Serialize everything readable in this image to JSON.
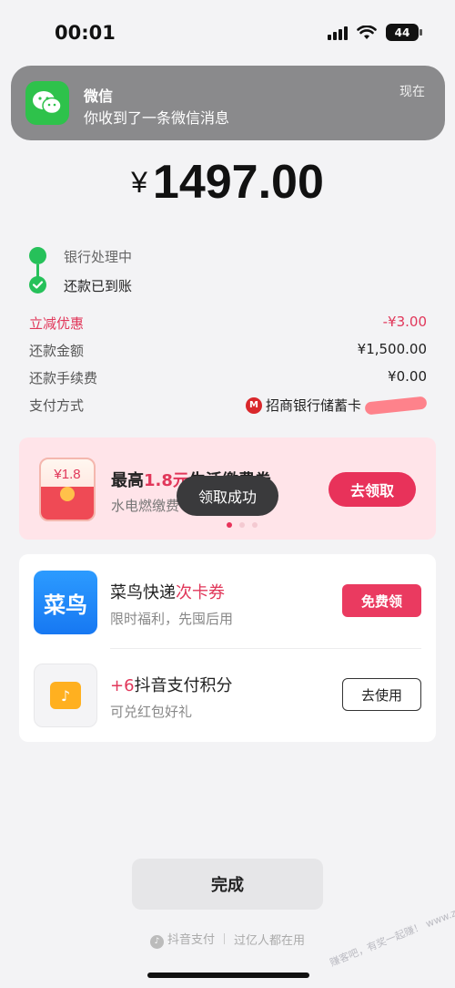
{
  "status_bar": {
    "time": "00:01",
    "battery": "44"
  },
  "notification": {
    "app": "微信",
    "message": "你收到了一条微信消息",
    "time": "现在",
    "icon": "wechat-icon"
  },
  "payment": {
    "currency": "¥",
    "amount": "1497.00"
  },
  "steps": [
    {
      "label": "银行处理中"
    },
    {
      "label": "还款已到账"
    }
  ],
  "details": {
    "discount_label": "立减优惠",
    "discount_value": "-¥3.00",
    "repay_label": "还款金额",
    "repay_value": "¥1,500.00",
    "fee_label": "还款手续费",
    "fee_value": "¥0.00",
    "method_label": "支付方式",
    "method_value": "招商银行储蓄卡"
  },
  "promo": {
    "envelope_value": "¥1.8",
    "title_prefix": "最高",
    "title_highlight": "1.8元",
    "title_suffix": "生活缴费券",
    "subtitle": "水电燃缴费",
    "button": "去领取"
  },
  "toast": "领取成功",
  "offers": [
    {
      "logo_text": "菜鸟",
      "title_main": "菜鸟快递",
      "title_highlight": "次卡券",
      "subtitle": "限时福利，先囤后用",
      "button": "免费领"
    },
    {
      "logo_text": "♪",
      "title_highlight": "+6",
      "title_main": "抖音支付积分",
      "subtitle": "可兑红包好礼",
      "button": "去使用"
    }
  ],
  "done_button": "完成",
  "footer": {
    "brand": "抖音支付",
    "slogan": "过亿人都在用"
  },
  "watermark": "赚客吧，有奖一起赚！ www.zuanke8.com",
  "colors": {
    "accent": "#e8325a",
    "success": "#26c15a",
    "wechat": "#2ec24b"
  }
}
